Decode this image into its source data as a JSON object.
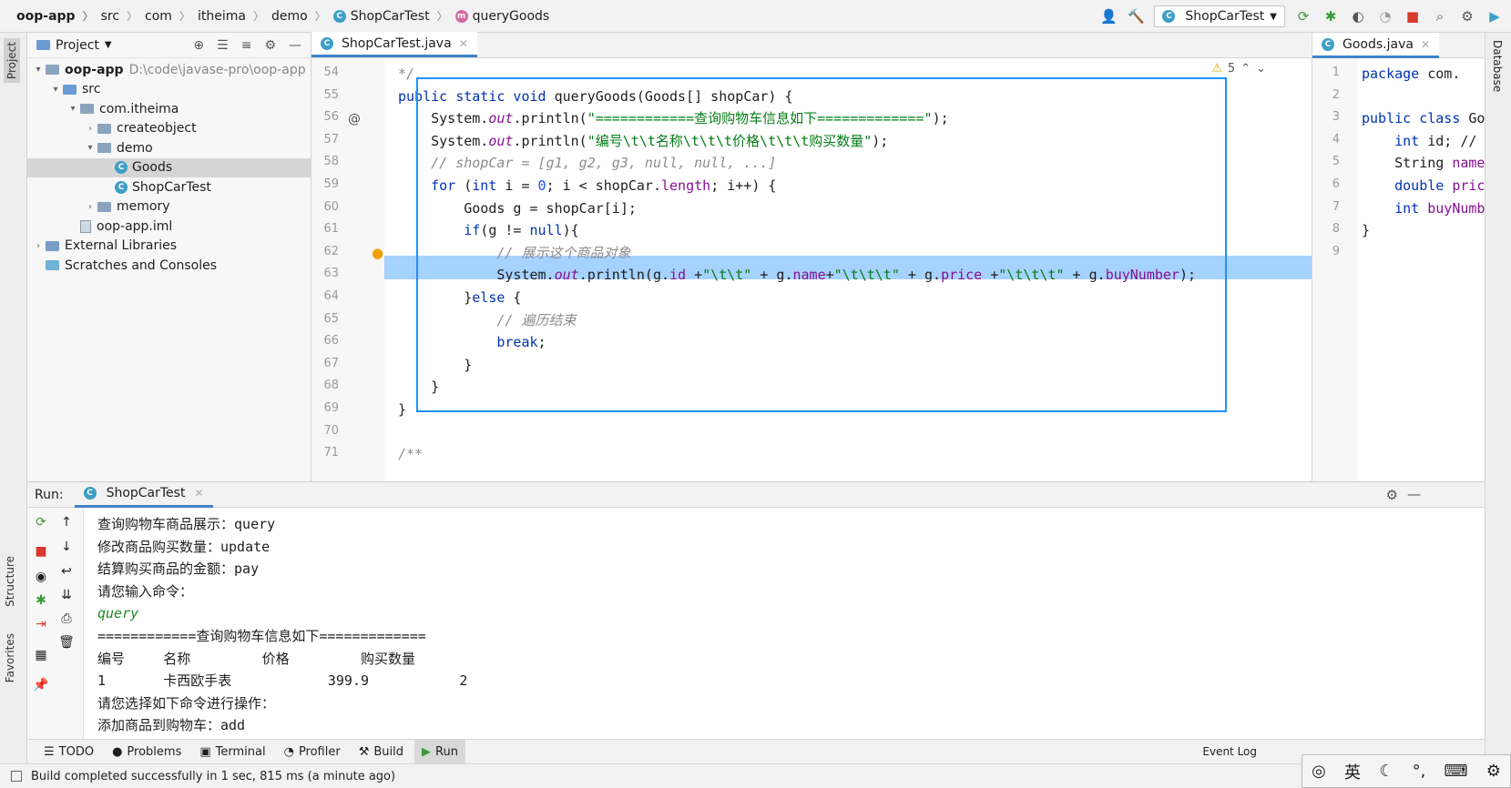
{
  "breadcrumb": [
    "oop-app",
    "src",
    "com",
    "itheima",
    "demo",
    "ShopCarTest",
    "queryGoods"
  ],
  "run_config": "ShopCarTest",
  "project_panel": {
    "title": "Project",
    "tree": [
      {
        "label": "oop-app",
        "hint": "D:\\code\\javase-pro\\oop-app",
        "indent": 0,
        "arrow": "v",
        "kind": "module"
      },
      {
        "label": "src",
        "indent": 1,
        "arrow": "v",
        "kind": "src"
      },
      {
        "label": "com.itheima",
        "indent": 2,
        "arrow": "v",
        "kind": "pkg"
      },
      {
        "label": "createobject",
        "indent": 3,
        "arrow": ">",
        "kind": "pkg"
      },
      {
        "label": "demo",
        "indent": 3,
        "arrow": "v",
        "kind": "pkg"
      },
      {
        "label": "Goods",
        "indent": 4,
        "arrow": "",
        "kind": "class",
        "selected": true
      },
      {
        "label": "ShopCarTest",
        "indent": 4,
        "arrow": "",
        "kind": "class"
      },
      {
        "label": "memory",
        "indent": 3,
        "arrow": ">",
        "kind": "pkg"
      },
      {
        "label": "oop-app.iml",
        "indent": 2,
        "arrow": "",
        "kind": "file"
      },
      {
        "label": "External Libraries",
        "indent": 0,
        "arrow": ">",
        "kind": "lib"
      },
      {
        "label": "Scratches and Consoles",
        "indent": 0,
        "arrow": "",
        "kind": "scratch"
      }
    ]
  },
  "editor": {
    "tab": "ShopCarTest.java",
    "warnings": "5",
    "line_numbers": [
      "54",
      "55",
      "56",
      "57",
      "58",
      "59",
      "60",
      "61",
      "62",
      "63",
      "64",
      "65",
      "66",
      "67",
      "68",
      "69",
      "70",
      "71"
    ],
    "lines": [
      [
        {
          "t": "*/",
          "c": "cmt"
        }
      ],
      [
        {
          "t": "public static void ",
          "c": "kw"
        },
        {
          "t": "queryGoods(Goods[] shopCar) {",
          "c": ""
        }
      ],
      [
        {
          "t": "    System.",
          "c": ""
        },
        {
          "t": "out",
          "c": "fldi"
        },
        {
          "t": ".println(",
          "c": ""
        },
        {
          "t": "\"============查询购物车信息如下=============\"",
          "c": "str"
        },
        {
          "t": ");",
          "c": ""
        }
      ],
      [
        {
          "t": "    System.",
          "c": ""
        },
        {
          "t": "out",
          "c": "fldi"
        },
        {
          "t": ".println(",
          "c": ""
        },
        {
          "t": "\"编号\\t\\t名称\\t\\t\\t价格\\t\\t\\t购买数量\"",
          "c": "str"
        },
        {
          "t": ");",
          "c": ""
        }
      ],
      [
        {
          "t": "    // shopCar = [g1, g2, g3, null, null, ...]",
          "c": "cmt"
        }
      ],
      [
        {
          "t": "    ",
          "c": ""
        },
        {
          "t": "for",
          "c": "kw"
        },
        {
          "t": " (",
          "c": ""
        },
        {
          "t": "int",
          "c": "kw"
        },
        {
          "t": " i = ",
          "c": ""
        },
        {
          "t": "0",
          "c": "num"
        },
        {
          "t": "; i < shopCar.",
          "c": ""
        },
        {
          "t": "length",
          "c": "fld"
        },
        {
          "t": "; i++) {",
          "c": ""
        }
      ],
      [
        {
          "t": "        Goods g = shopCar[i];",
          "c": ""
        }
      ],
      [
        {
          "t": "        ",
          "c": ""
        },
        {
          "t": "if",
          "c": "kw"
        },
        {
          "t": "(g != ",
          "c": ""
        },
        {
          "t": "null",
          "c": "kw"
        },
        {
          "t": "){",
          "c": ""
        }
      ],
      [
        {
          "t": "            // 展示这个商品对象",
          "c": "cmt"
        }
      ],
      [
        {
          "t": "            System.",
          "c": ""
        },
        {
          "t": "out",
          "c": "fldi"
        },
        {
          "t": ".println(g.",
          "c": ""
        },
        {
          "t": "id",
          "c": "fld"
        },
        {
          "t": " +",
          "c": ""
        },
        {
          "t": "\"\\t\\t\"",
          "c": "str"
        },
        {
          "t": " + g.",
          "c": ""
        },
        {
          "t": "name",
          "c": "fld"
        },
        {
          "t": "+",
          "c": ""
        },
        {
          "t": "\"\\t\\t\\t\"",
          "c": "str"
        },
        {
          "t": " + g.",
          "c": ""
        },
        {
          "t": "price",
          "c": "fld"
        },
        {
          "t": " +",
          "c": ""
        },
        {
          "t": "\"\\t\\t\\t\"",
          "c": "str"
        },
        {
          "t": " + g.",
          "c": ""
        },
        {
          "t": "buyNumber",
          "c": "fld"
        },
        {
          "t": ");",
          "c": ""
        }
      ],
      [
        {
          "t": "        }",
          "c": ""
        },
        {
          "t": "else",
          "c": "kw"
        },
        {
          "t": " {",
          "c": ""
        }
      ],
      [
        {
          "t": "            // 遍历结束",
          "c": "cmt"
        }
      ],
      [
        {
          "t": "            ",
          "c": ""
        },
        {
          "t": "break",
          "c": "kw"
        },
        {
          "t": ";",
          "c": ""
        }
      ],
      [
        {
          "t": "        }",
          "c": ""
        }
      ],
      [
        {
          "t": "    }",
          "c": ""
        }
      ],
      [
        {
          "t": "}",
          "c": ""
        }
      ],
      [
        {
          "t": "",
          "c": ""
        }
      ],
      [
        {
          "t": "/**",
          "c": "cmt"
        }
      ]
    ]
  },
  "editor2": {
    "tab": "Goods.java",
    "line_numbers": [
      "1",
      "2",
      "3",
      "4",
      "5",
      "6",
      "7",
      "8",
      "9"
    ],
    "lines": [
      [
        {
          "t": "package",
          "c": "kw"
        },
        {
          "t": " com.",
          "c": ""
        }
      ],
      [
        {
          "t": "",
          "c": ""
        }
      ],
      [
        {
          "t": "public class ",
          "c": "kw"
        },
        {
          "t": "Go",
          "c": ""
        }
      ],
      [
        {
          "t": "    ",
          "c": ""
        },
        {
          "t": "int",
          "c": "kw"
        },
        {
          "t": " id; //",
          "c": ""
        }
      ],
      [
        {
          "t": "    String ",
          "c": ""
        },
        {
          "t": "name",
          "c": "fld"
        }
      ],
      [
        {
          "t": "    ",
          "c": ""
        },
        {
          "t": "double",
          "c": "kw"
        },
        {
          "t": " pric",
          "c": "fld"
        }
      ],
      [
        {
          "t": "    ",
          "c": ""
        },
        {
          "t": "int",
          "c": "kw"
        },
        {
          "t": " buyNumb",
          "c": "fld"
        }
      ],
      [
        {
          "t": "}",
          "c": ""
        }
      ],
      [
        {
          "t": "",
          "c": ""
        }
      ]
    ]
  },
  "run_panel": {
    "label": "Run:",
    "tab": "ShopCarTest",
    "console": [
      {
        "text": "查询购物车商品展示：query",
        "input": false
      },
      {
        "text": "修改商品购买数量：update",
        "input": false
      },
      {
        "text": "结算购买商品的金额：pay",
        "input": false
      },
      {
        "text": "请您输入命令：",
        "input": false
      },
      {
        "text": "query",
        "input": true
      },
      {
        "text": "============查询购物车信息如下=============",
        "input": false
      },
      {
        "text": "编号\t\t名称\t\t\t价格\t\t\t购买数量",
        "input": false
      },
      {
        "text": "1\t\t卡西欧手表\t\t\t399.9\t\t\t2",
        "input": false
      },
      {
        "text": "请您选择如下命令进行操作：",
        "input": false
      },
      {
        "text": "添加商品到购物车：add",
        "input": false
      }
    ]
  },
  "bottom_tabs": [
    "TODO",
    "Problems",
    "Terminal",
    "Profiler",
    "Build",
    "Run"
  ],
  "left_stripe": {
    "project": "Project",
    "structure": "Structure",
    "favorites": "Favorites"
  },
  "right_stripe": {
    "database": "Database"
  },
  "status": "Build completed successfully in 1 sec, 815 ms (a minute ago)",
  "event_log": "Event Log",
  "ime": {
    "lang": "英"
  }
}
